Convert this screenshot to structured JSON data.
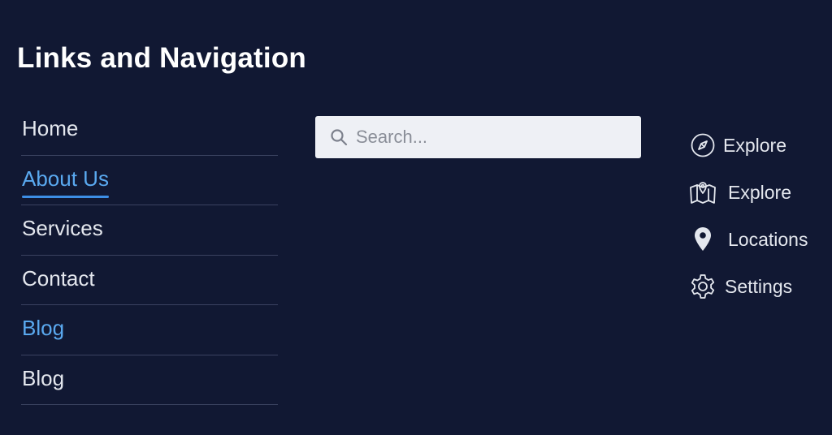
{
  "page": {
    "title": "Links and Navigation"
  },
  "nav": {
    "items": [
      {
        "label": "Home",
        "state": "default"
      },
      {
        "label": "About Us",
        "state": "active"
      },
      {
        "label": "Services",
        "state": "default"
      },
      {
        "label": "Contact",
        "state": "default"
      },
      {
        "label": "Blog",
        "state": "highlight"
      },
      {
        "label": "Blog",
        "state": "default"
      }
    ]
  },
  "search": {
    "placeholder": "Search...",
    "value": "",
    "icon": "search-icon"
  },
  "side_links": {
    "items": [
      {
        "label": "Explore",
        "icon": "compass-icon"
      },
      {
        "label": "Explore",
        "icon": "map-icon"
      },
      {
        "label": "Locations",
        "icon": "location-pin-icon"
      },
      {
        "label": "Settings",
        "icon": "gear-icon"
      }
    ]
  },
  "colors": {
    "background": "#111833",
    "accent": "#3d8ee6",
    "link_highlight": "#5aa9f0",
    "text": "#e4e7ee",
    "search_bg": "#eef0f5"
  }
}
